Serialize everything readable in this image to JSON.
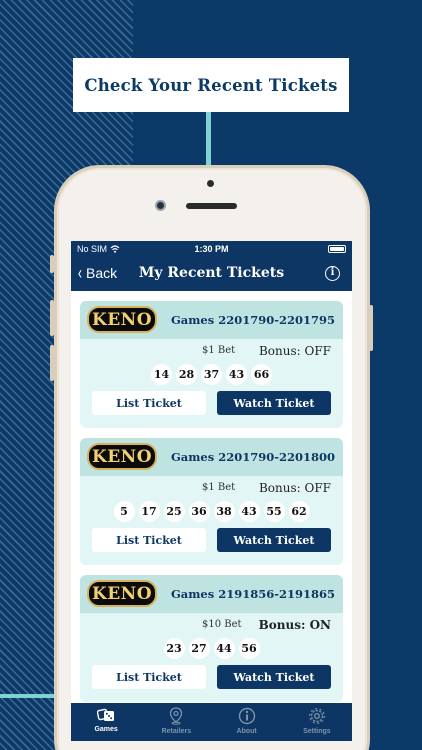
{
  "banner": {
    "text": "Check Your Recent Tickets"
  },
  "status_bar": {
    "carrier": "No SIM",
    "time": "1:30 PM"
  },
  "nav": {
    "back_label": "Back",
    "title": "My Recent Tickets"
  },
  "tickets": [
    {
      "logo": "KENO",
      "games": "Games 2201790-2201795",
      "bet": "$1 Bet",
      "bonus": "Bonus: OFF",
      "numbers": [
        "14",
        "28",
        "37",
        "43",
        "66"
      ],
      "list_label": "List Ticket",
      "watch_label": "Watch Ticket"
    },
    {
      "logo": "KENO",
      "games": "Games 2201790-2201800",
      "bet": "$1 Bet",
      "bonus": "Bonus: OFF",
      "numbers": [
        "5",
        "17",
        "25",
        "36",
        "38",
        "43",
        "55",
        "62"
      ],
      "list_label": "List Ticket",
      "watch_label": "Watch Ticket"
    },
    {
      "logo": "KENO",
      "games": "Games 2191856-2191865",
      "bet": "$10 Bet",
      "bonus": "Bonus: ON",
      "numbers": [
        "23",
        "27",
        "44",
        "56"
      ],
      "list_label": "List Ticket",
      "watch_label": "Watch Ticket"
    }
  ],
  "tabs": [
    {
      "label": "Games",
      "icon": "dice-icon",
      "active": true
    },
    {
      "label": "Retailers",
      "icon": "map-pin-icon",
      "active": false
    },
    {
      "label": "About",
      "icon": "info-circle-icon",
      "active": false
    },
    {
      "label": "Settings",
      "icon": "gear-icon",
      "active": false
    }
  ],
  "colors": {
    "navy": "#0d3664",
    "background": "#0c3a68",
    "card": "#e2f6f6",
    "card_header": "#bfe3e1",
    "teal_accent": "#7fd3d2"
  }
}
